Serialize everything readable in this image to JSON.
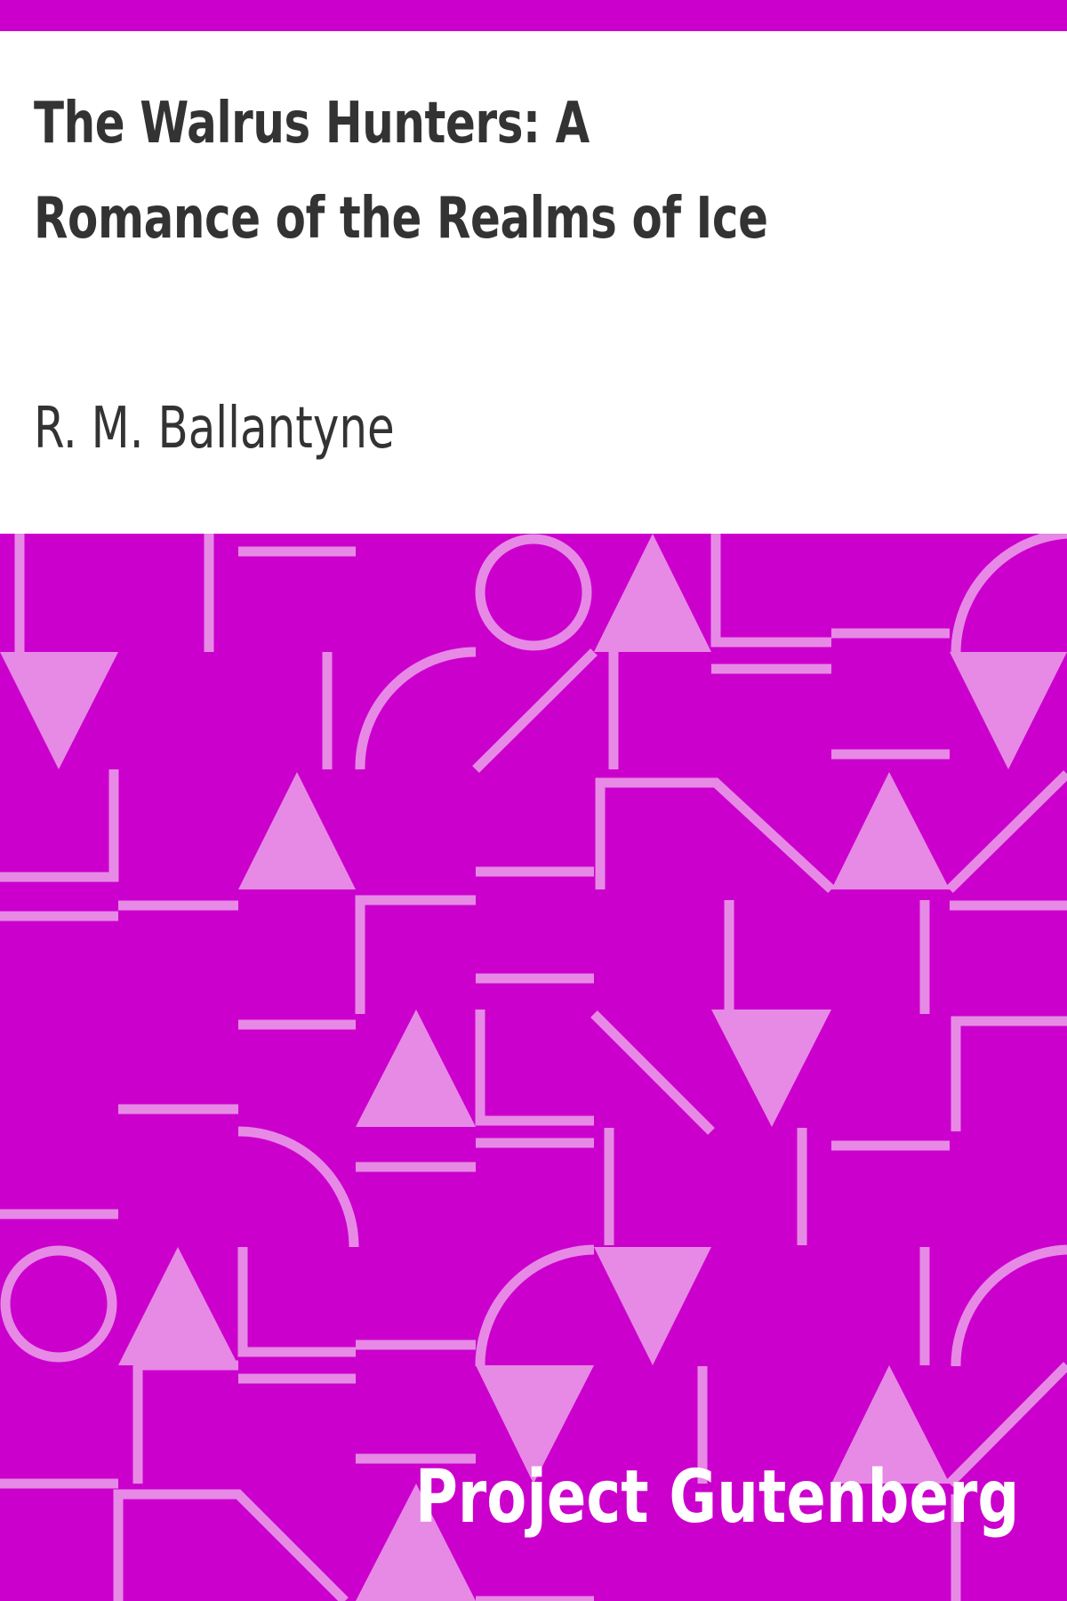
{
  "cover": {
    "title": "The Walrus Hunters: A Romance of the Realms of Ice",
    "author": "R. M. Ballantyne",
    "publisher_mark": "Project Gutenberg",
    "colors": {
      "band": "#cc00cc",
      "pattern_background": "#cc00cc",
      "pattern_shapes": "#e68ae6",
      "text": "#333333",
      "brand_text": "#ffffff"
    },
    "pattern_icon": "geometric-tiles-icon"
  }
}
